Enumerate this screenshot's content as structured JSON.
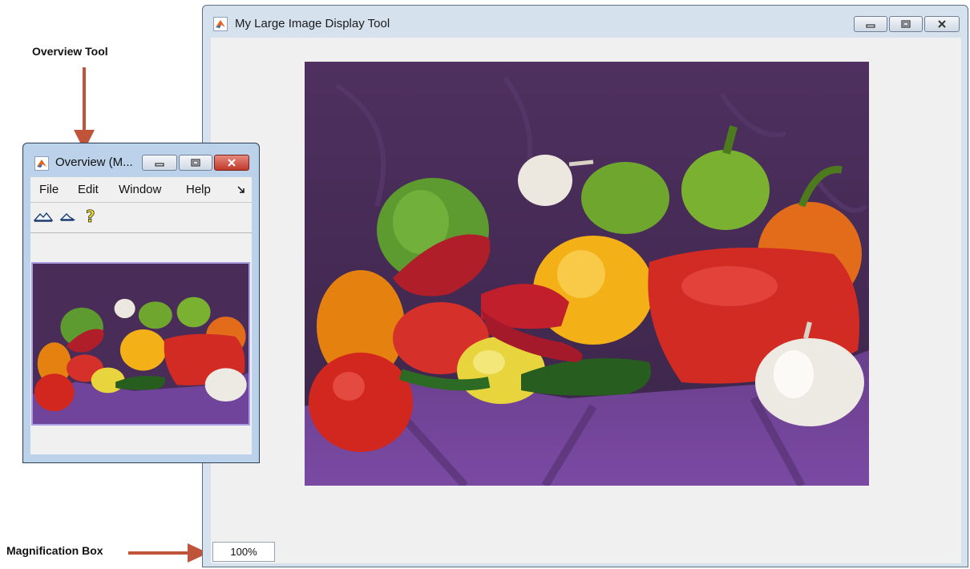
{
  "annotations": {
    "overview_tool_label": "Overview Tool",
    "magnification_box_label": "Magnification Box",
    "arrow_color": "#c0543a"
  },
  "main_window": {
    "title": "My Large Image Display Tool",
    "magnification_value": "100%",
    "image_subject": "peppers"
  },
  "overview_window": {
    "title": "Overview (M...",
    "menu": [
      "File",
      "Edit",
      "Window",
      "Help"
    ],
    "toolbar_icons": [
      "zoom-in-icon",
      "zoom-out-icon",
      "help-icon"
    ]
  },
  "colors": {
    "titlebar": "#d6e1ee",
    "overview_titlebar": "#bcd2ea",
    "close_button": "#c94a3c",
    "client_background": "#f0f0f0",
    "overview_frame": "#a79ee6"
  }
}
